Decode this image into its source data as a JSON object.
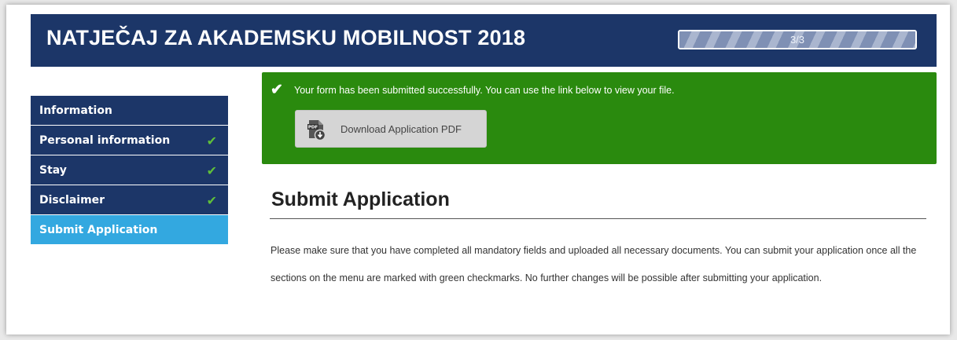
{
  "header": {
    "title": "NATJEČAJ ZA AKADEMSKU MOBILNOST 2018",
    "progress_text": "3/3",
    "progress_fraction": 1.0
  },
  "sidebar": {
    "items": [
      {
        "label": "Information",
        "checked": false,
        "active": false
      },
      {
        "label": "Personal information",
        "checked": true,
        "active": false
      },
      {
        "label": "Stay",
        "checked": true,
        "active": false
      },
      {
        "label": "Disclaimer",
        "checked": true,
        "active": false
      },
      {
        "label": "Submit Application",
        "checked": false,
        "active": true
      }
    ],
    "check_icon": "checkmark-icon"
  },
  "success": {
    "message": "Your form has been submitted successfully. You can use the link below to view your file.",
    "icon": "checkmark-icon",
    "download_label": "Download Application PDF",
    "download_icon": "pdf-download-icon"
  },
  "main": {
    "title": "Submit Application",
    "paragraph": "Please make sure that you have completed all mandatory fields and uploaded all necessary documents. You can submit your application once all the sections on the menu are marked with green checkmarks. No further changes will be possible after submitting your application."
  },
  "colors": {
    "header_bg": "#1c3668",
    "active_item": "#33a8e0",
    "success_bg": "#2a8a0e",
    "check": "#5fbf3a"
  }
}
